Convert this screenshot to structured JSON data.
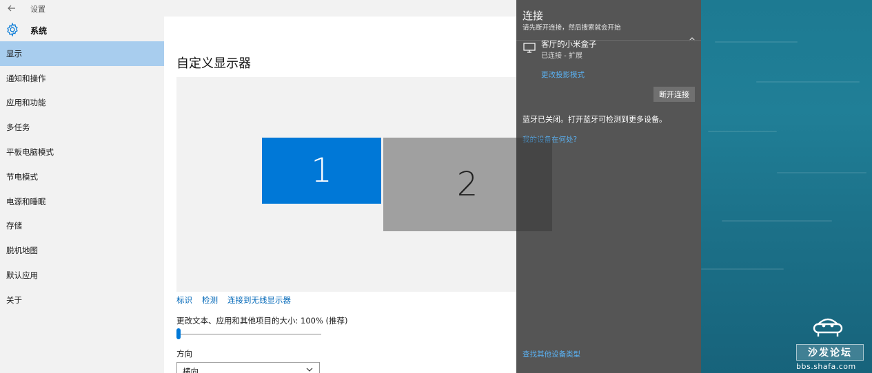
{
  "settings": {
    "window_title": "设置",
    "sidebar": {
      "header": "系统",
      "items": [
        {
          "label": "显示",
          "active": true
        },
        {
          "label": "通知和操作"
        },
        {
          "label": "应用和功能"
        },
        {
          "label": "多任务"
        },
        {
          "label": "平板电脑模式"
        },
        {
          "label": "节电模式"
        },
        {
          "label": "电源和睡眠"
        },
        {
          "label": "存储"
        },
        {
          "label": "脱机地图"
        },
        {
          "label": "默认应用"
        },
        {
          "label": "关于"
        }
      ]
    },
    "content": {
      "title": "自定义显示器",
      "monitor1_label": "1",
      "monitor2_label": "2",
      "links": [
        "标识",
        "检测",
        "连接到无线显示器"
      ],
      "scale_label": "更改文本、应用和其他项目的大小: 100% (推荐)",
      "scale_level_percent": 0,
      "orientation_label": "方向",
      "orientation_value": "横向"
    }
  },
  "connect": {
    "title": "连接",
    "subtitle": "请先断开连接，然后搜索就会开始",
    "device": {
      "name": "客厅的小米盒子",
      "status": "已连接 - 扩展",
      "project_mode_link": "更改投影模式",
      "disconnect_button": "断开连接"
    },
    "bluetooth_note": "蓝牙已关闭。打开蓝牙可检测到更多设备。",
    "where_link": "我的设备在何处?",
    "find_other_link": "查找其他设备类型"
  },
  "watermark": {
    "brand": "沙发论坛",
    "url": "bbs.shafa.com"
  },
  "colors": {
    "accent": "#0078d7",
    "active_nav": "#a8cdee",
    "panel_bg": "#555555",
    "link_dark": "#5ab0f0"
  }
}
